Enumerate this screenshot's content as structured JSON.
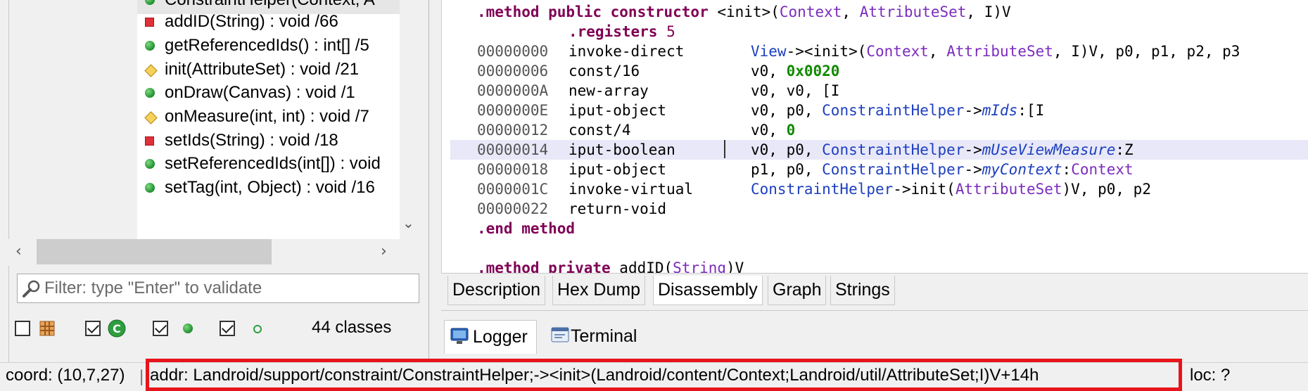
{
  "methods": [
    {
      "label": "ConstraintHelper(Context, A",
      "visibility": "public"
    },
    {
      "label": "addID(String) : void  /66",
      "visibility": "private"
    },
    {
      "label": "getReferencedIds() : int[]  /5",
      "visibility": "public"
    },
    {
      "label": "init(AttributeSet) : void  /21",
      "visibility": "package"
    },
    {
      "label": "onDraw(Canvas) : void  /1",
      "visibility": "public"
    },
    {
      "label": "onMeasure(int, int) : void  /7",
      "visibility": "package"
    },
    {
      "label": "setIds(String) : void  /18",
      "visibility": "private"
    },
    {
      "label": "setReferencedIds(int[]) : void",
      "visibility": "public"
    },
    {
      "label": "setTag(int, Object) : void  /16",
      "visibility": "public"
    }
  ],
  "filter": {
    "placeholder": "Filter: type \"Enter\" to validate",
    "value": ""
  },
  "class_count": "44 classes",
  "code": {
    "header_kw": ".method public constructor",
    "header_name": " <init>(",
    "header_p1": "Context",
    "header_sep1": ", ",
    "header_p2": "AttributeSet",
    "header_end": ", I)V",
    "registers": ".registers 5",
    "lines": [
      {
        "addr": "00000000",
        "op": "invoke-direct"
      },
      {
        "addr": "00000006",
        "op": "const/16"
      },
      {
        "addr": "0000000A",
        "op": "new-array"
      },
      {
        "addr": "0000000E",
        "op": "iput-object"
      },
      {
        "addr": "00000012",
        "op": "const/4"
      },
      {
        "addr": "00000014",
        "op": "iput-boolean"
      },
      {
        "addr": "00000018",
        "op": "iput-object"
      },
      {
        "addr": "0000001C",
        "op": "invoke-virtual"
      },
      {
        "addr": "00000022",
        "op": "return-void"
      }
    ],
    "a0": {
      "c1": "View",
      "t1": "-><init>(",
      "c2": "Context",
      "t2": ", ",
      "c3": "AttributeSet",
      "t3": ", I)V, p0, p1, p2, p3"
    },
    "a1": {
      "t1": "v0, ",
      "n": "0x0020"
    },
    "a2": {
      "t1": "v0, v0, [I"
    },
    "a3": {
      "t1": "v0, p0, ",
      "c1": "ConstraintHelper",
      "t2": "->",
      "f": "mIds",
      "t3": ":[I"
    },
    "a4": {
      "t1": "v0, ",
      "n": "0"
    },
    "a5": {
      "t1": "v0, p0, ",
      "c1": "ConstraintHelper",
      "t2": "->",
      "f": "mUseViewMeasure",
      "t3": ":Z"
    },
    "a6": {
      "t1": "p1, p0, ",
      "c1": "ConstraintHelper",
      "t2": "->",
      "f": "myContext",
      "t3": ":",
      "c2": "Context"
    },
    "a7": {
      "c1": "ConstraintHelper",
      "t1": "->init(",
      "c2": "AttributeSet",
      "t2": ")V, p0, p2"
    },
    "end": ".end method",
    "next_kw": ".method private",
    "next_name": " addID(",
    "next_p1": "String",
    "next_end": ")V"
  },
  "tabs": [
    "Description",
    "Hex Dump",
    "Disassembly",
    "Graph",
    "Strings"
  ],
  "active_tab": "Disassembly",
  "bottom_tabs": [
    "Logger",
    "Terminal"
  ],
  "status": {
    "coord": "coord: (10,7,27)",
    "separator": "|",
    "addr": "addr: Landroid/support/constraint/ConstraintHelper;-><init>(Landroid/content/Context;Landroid/util/AttributeSet;I)V+14h",
    "loc": "loc: ?"
  },
  "colors": {
    "highlight_box": "#e8141b",
    "keyword": "#7f0055",
    "class_ref": "#1d3fbf",
    "number": "#118a00"
  }
}
